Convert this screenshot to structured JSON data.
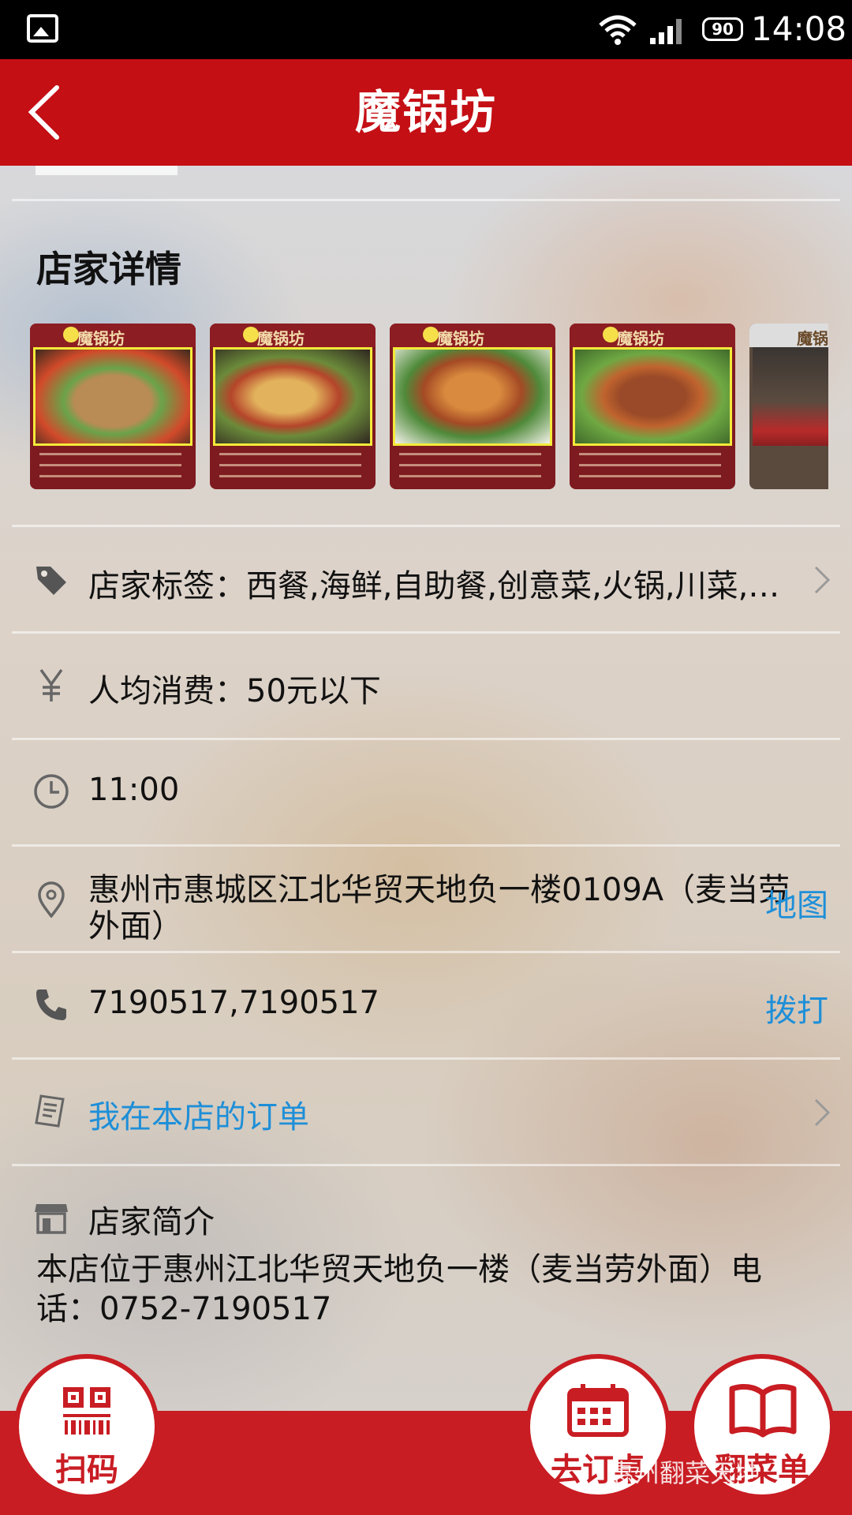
{
  "status_bar": {
    "time": "14:08",
    "battery": "90"
  },
  "header": {
    "title": "魔锅坊"
  },
  "details": {
    "section_title": "店家详情"
  },
  "thumbnails": [
    {
      "label": "魔锅坊"
    },
    {
      "label": "魔锅坊"
    },
    {
      "label": "魔锅坊"
    },
    {
      "label": "魔锅坊"
    },
    {
      "label": "魔锅坊"
    }
  ],
  "info": {
    "tags": "店家标签：西餐,海鲜,自助餐,创意菜,火锅,川菜,湘...",
    "avg_spend": "人均消费：50元以下",
    "hours": "11:00",
    "address_line1": "惠州市惠城区江北华贸天地负一楼0109A（麦当劳",
    "address_line2": "外面）",
    "map_action": "地图",
    "phone": "7190517,7190517",
    "call_action": "拨打",
    "my_orders": "我在本店的订单",
    "intro_title": "店家简介",
    "intro_line1": "本店位于惠州江北华贸天地负一楼（麦当劳外面）电",
    "intro_line2": "话：0752-7190517"
  },
  "bottom": {
    "scan": "扫码",
    "reserve": "去订桌",
    "menu": "翻菜单",
    "watermark": "惠州翻菜天地"
  },
  "colors": {
    "brand_red": "#c40f15",
    "link_blue": "#1e8fd8"
  }
}
